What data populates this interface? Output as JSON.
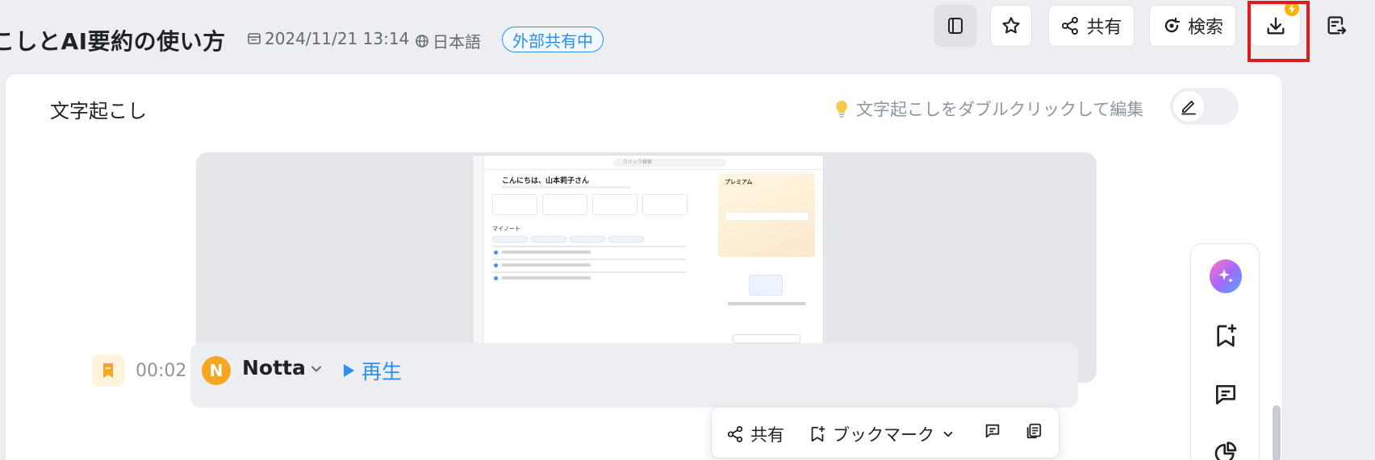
{
  "header": {
    "title": "こしとAI要約の使い方",
    "date": "2024/11/21 13:14",
    "language": "日本語",
    "share_status": "外部共有中"
  },
  "toolbar": {
    "share_label": "共有",
    "search_label": "検索"
  },
  "transcript": {
    "section_title": "文字起こし",
    "hint": "文字起こしをダブルクリックして編集",
    "segment": {
      "timestamp": "00:02",
      "avatar_initial": "N",
      "speaker": "Notta",
      "play_label": "再生"
    }
  },
  "embedded_screenshot": {
    "greeting": "こんにちは、山本莉子さん",
    "my_notes": "マイノート",
    "premium": "プレミアム",
    "search_placeholder": "クイック検索"
  },
  "float_toolbar": {
    "share_label": "共有",
    "bookmark_label": "ブックマーク"
  },
  "icons": {
    "panel": "panel-toggle-icon",
    "star": "star-icon",
    "share": "share-icon",
    "search": "search-icon",
    "download": "download-icon",
    "export": "export-icon",
    "ai": "ai-sparkle-icon",
    "bookmark_add": "bookmark-add-icon",
    "comment": "comment-icon",
    "chart": "pie-chart-icon"
  },
  "colors": {
    "accent": "#2d8ef0",
    "highlight": "#e01b1b",
    "avatar": "#f5a623",
    "pro_badge": "#f5b400"
  }
}
